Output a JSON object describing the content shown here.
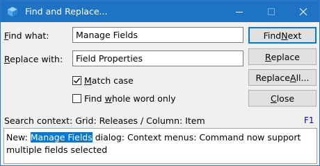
{
  "window": {
    "title": "Find and Replace...",
    "accent_color": "#1e73c4"
  },
  "find": {
    "label_hotkey": "F",
    "label_rest": "ind what:",
    "value": "Manage Fields"
  },
  "replace": {
    "label_hotkey": "R",
    "label_rest": "eplace with:",
    "value": "Field Properties"
  },
  "options": {
    "match_case": {
      "hotkey": "M",
      "rest": "atch case",
      "checked": true
    },
    "whole_word": {
      "pre": "Find ",
      "hotkey": "w",
      "rest": "hole word only",
      "checked": false
    }
  },
  "buttons": {
    "find_next": {
      "pre": "Find ",
      "hotkey": "N",
      "rest": "ext"
    },
    "replace": {
      "pre": "",
      "hotkey": "R",
      "rest": "eplace"
    },
    "replace_all": {
      "pre": "Replace ",
      "hotkey": "A",
      "rest": "ll..."
    },
    "close": {
      "pre": "",
      "hotkey": "C",
      "rest": "lose"
    }
  },
  "status": {
    "search_context": "Search context: Grid: Releases / Column: Item",
    "help_key": "F1"
  },
  "note": {
    "prefix": "New: ",
    "highlight": "Manage Fields",
    "suffix": " dialog: Context menus: Command now support multiple fields selected"
  },
  "icons": {
    "app": "cube-icon",
    "minimize": "minimize-icon",
    "maximize": "maximize-icon",
    "close": "close-icon",
    "check": "checkmark-icon"
  }
}
